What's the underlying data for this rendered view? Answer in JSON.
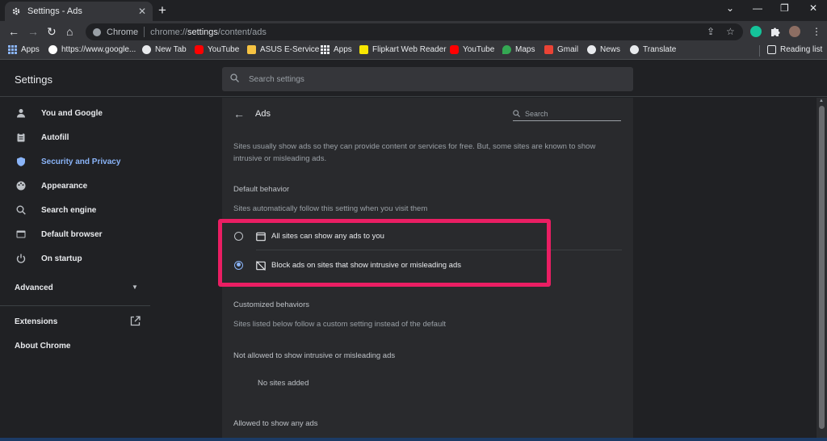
{
  "tab": {
    "title": "Settings - Ads",
    "close": "✕",
    "new_tab": "+"
  },
  "window_controls": {
    "chevron": "⌄",
    "minimize": "—",
    "restore": "❐",
    "close": "✕"
  },
  "toolbar": {
    "back": "←",
    "forward": "→",
    "reload": "↻",
    "home": "⌂",
    "omnibox_label": "Chrome",
    "url_prefix": "chrome://",
    "url_host": "settings",
    "url_path": "/content/ads",
    "share": "⇪",
    "bookmark": "☆",
    "menu": "⋮"
  },
  "bookmarks": [
    {
      "label": "Apps",
      "icon": "apps-grid-icon"
    },
    {
      "label": "https://www.google...",
      "icon": "google-icon"
    },
    {
      "label": "New Tab",
      "icon": "globe-icon"
    },
    {
      "label": "YouTube",
      "icon": "youtube-icon"
    },
    {
      "label": "ASUS E-Service",
      "icon": "folder-icon"
    },
    {
      "label": "Apps",
      "icon": "apps-grid-icon"
    },
    {
      "label": "Flipkart Web Reader",
      "icon": "flipkart-icon"
    },
    {
      "label": "YouTube",
      "icon": "youtube-icon"
    },
    {
      "label": "Maps",
      "icon": "maps-pin-icon"
    },
    {
      "label": "Gmail",
      "icon": "gmail-icon"
    },
    {
      "label": "News",
      "icon": "globe-icon"
    },
    {
      "label": "Translate",
      "icon": "globe-icon"
    }
  ],
  "reading_list": "Reading list",
  "settings": {
    "title": "Settings",
    "search_placeholder": "Search settings"
  },
  "sidebar": {
    "items": [
      {
        "label": "You and Google",
        "icon": "person-icon",
        "active": false
      },
      {
        "label": "Autofill",
        "icon": "clipboard-icon",
        "active": false
      },
      {
        "label": "Security and Privacy",
        "icon": "shield-icon",
        "active": true
      },
      {
        "label": "Appearance",
        "icon": "palette-icon",
        "active": false
      },
      {
        "label": "Search engine",
        "icon": "search-icon",
        "active": false
      },
      {
        "label": "Default browser",
        "icon": "browser-icon",
        "active": false
      },
      {
        "label": "On startup",
        "icon": "power-icon",
        "active": false
      }
    ],
    "advanced": "Advanced",
    "extensions": "Extensions",
    "about": "About Chrome"
  },
  "ads": {
    "title": "Ads",
    "search_placeholder": "Search",
    "description": "Sites usually show ads so they can provide content or services for free. But, some sites are known to show intrusive or misleading ads.",
    "default_behavior": "Default behavior",
    "default_behavior_sub": "Sites automatically follow this setting when you visit them",
    "option_allow": "All sites can show any ads to you",
    "option_block": "Block ads on sites that show intrusive or misleading ads",
    "selected": "block",
    "customized": "Customized behaviors",
    "customized_sub": "Sites listed below follow a custom setting instead of the default",
    "not_allowed": "Not allowed to show intrusive or misleading ads",
    "no_sites": "No sites added",
    "allowed": "Allowed to show any ads"
  },
  "colors": {
    "accent": "#8ab4f8",
    "highlight": "#ea1e63",
    "background": "#202124",
    "card": "#292a2d"
  }
}
